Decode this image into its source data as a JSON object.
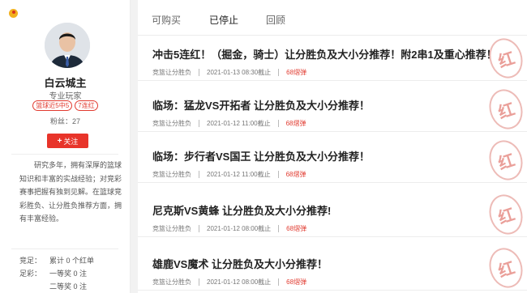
{
  "profile": {
    "name": "白云城主",
    "title": "专业玩家",
    "tags": [
      "篮球近5中5",
      "7连红"
    ],
    "fans": "粉丝：27",
    "follow_label": "关注",
    "follow_icon": "plus-icon",
    "bio": "研究多年，拥有深厚的篮球知识和丰富的实战经验；对竞彩赛事把握有独到见解。在篮球竞彩胜负、让分胜负推荐方面，拥有丰富经验。",
    "stats": [
      {
        "label": "竞足：",
        "text": "累计 0 个红单"
      },
      {
        "label": "足彩：",
        "text": "一等奖 0 注"
      },
      {
        "label": "",
        "text": "二等奖 0 注"
      }
    ]
  },
  "tabs": [
    "可购买",
    "已停止",
    "回顾"
  ],
  "active_tab": "已停止",
  "items": [
    {
      "title": "冲击5连红！（掘金，骑士）让分胜负及大小分推荐！附2串1及重心推荐！",
      "category": "竞篮让分胜负",
      "time": "2021-01-13 08:30截止",
      "price": "68熠弹",
      "stamp": "红"
    },
    {
      "title": "临场：猛龙VS开拓者 让分胜负及大小分推荐！",
      "category": "竞篮让分胜负",
      "time": "2021-01-12 11:00截止",
      "price": "68熠弹",
      "stamp": "红"
    },
    {
      "title": "临场：步行者VS国王 让分胜负及大小分推荐！",
      "category": "竞篮让分胜负",
      "time": "2021-01-12 11:00截止",
      "price": "68熠弹",
      "stamp": "红"
    },
    {
      "title": "尼克斯VS黄蜂 让分胜负及大小分推荐!",
      "category": "竞篮让分胜负",
      "time": "2021-01-12 08:00截止",
      "price": "68熠弹",
      "stamp": "红"
    },
    {
      "title": "雄鹿VS魔术 让分胜负及大小分推荐！",
      "category": "竞篮让分胜负",
      "time": "2021-01-12 08:00截止",
      "price": "68熠弹",
      "stamp": "红"
    }
  ],
  "colors": {
    "accent": "#e8342a",
    "stamp": "#e78f88"
  }
}
